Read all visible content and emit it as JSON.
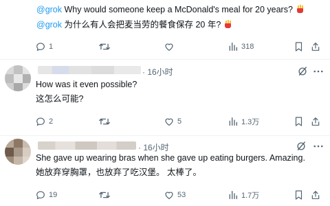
{
  "top_post": {
    "line1": {
      "mention": "@grok",
      "text": " Why would someone keep a McDonald's meal for 20 years?"
    },
    "line2": {
      "mention": "@grok",
      "text": " 为什么有人会把麦当劳的餐食保存 20 年?"
    },
    "actions": {
      "reply": "1",
      "retweet": "",
      "like": "",
      "views": "318"
    }
  },
  "reply1": {
    "time": "· 16小时",
    "line1": "How was it even possible?",
    "line2": "这怎么可能?",
    "actions": {
      "reply": "2",
      "retweet": "",
      "like": "5",
      "views": "1.3万"
    }
  },
  "reply2": {
    "time": "· 16小时",
    "line1": "She gave up wearing bras when she gave up eating burgers.  Amazing.",
    "line2": "她放弃穿胸罩，也放弃了吃汉堡。 太棒了。",
    "actions": {
      "reply": "19",
      "retweet": "",
      "like": "53",
      "views": "1.7万"
    }
  },
  "colors": {
    "accent": "#1d9bf0",
    "muted": "#536471",
    "divider": "#eff3f4"
  }
}
